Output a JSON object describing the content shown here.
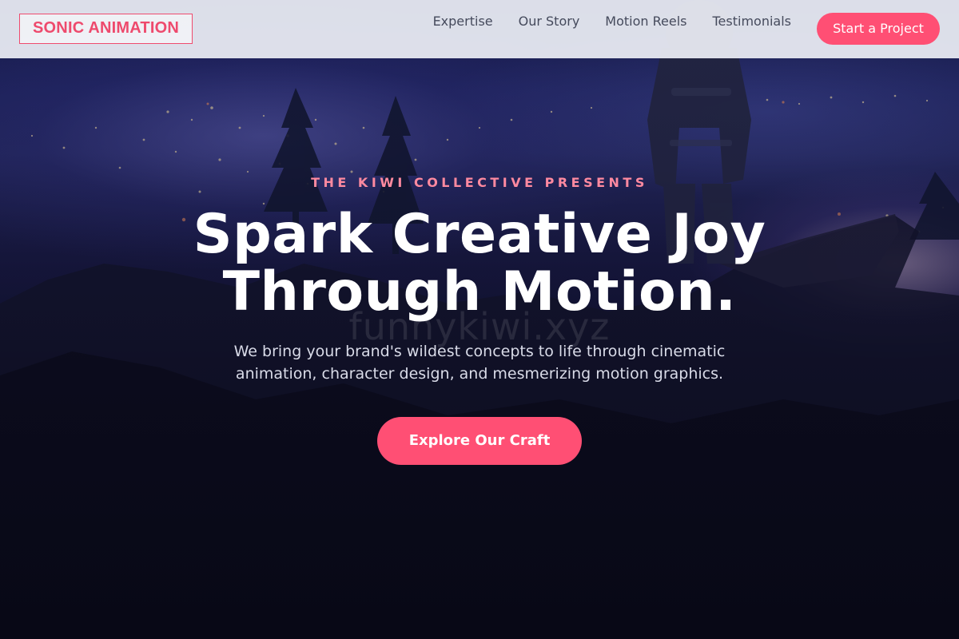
{
  "brand": {
    "logo_text": "SONIC ANIMATION",
    "accent_color": "#ff4f74"
  },
  "nav": {
    "links": [
      {
        "label": "Expertise"
      },
      {
        "label": "Our Story"
      },
      {
        "label": "Motion Reels"
      },
      {
        "label": "Testimonials"
      }
    ],
    "cta_label": "Start a Project"
  },
  "hero": {
    "eyebrow": "THE KIWI COLLECTIVE PRESENTS",
    "headline_line1": "Spark Creative Joy",
    "headline_line2": "Through Motion.",
    "subtext": "We bring your brand's wildest concepts to life through cinematic animation, character design, and mesmerizing motion graphics.",
    "cta_label": "Explore Our Craft",
    "watermark_text": "funnykiwi.xyz",
    "background_image": "night-cliff-astronaut-scene"
  }
}
